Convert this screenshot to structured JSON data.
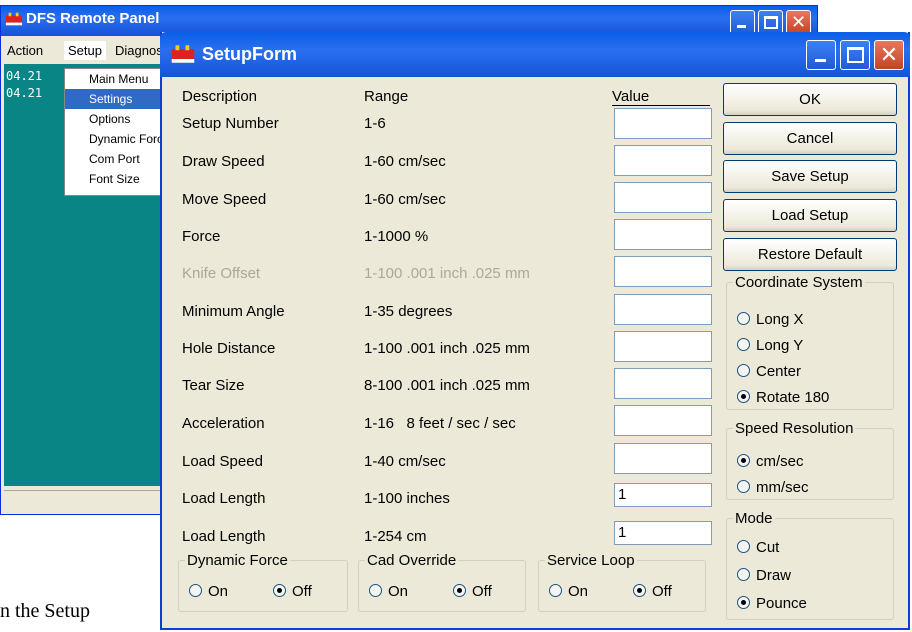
{
  "background_text": "n the Setup",
  "back_window": {
    "title": "DFS Remote Panel",
    "menu": [
      "Action",
      "Setup",
      "Diagnos"
    ],
    "console_lines": [
      "04.21",
      "04.21"
    ],
    "dropdown": [
      "Main Menu",
      "Settings",
      "Options",
      "Dynamic Forc",
      "Com Port",
      "Font Size"
    ]
  },
  "form": {
    "title": "SetupForm",
    "headers": {
      "description": "Description",
      "range": "Range",
      "value": "Value"
    },
    "rows": [
      {
        "description": "Setup Number",
        "range": "1-6",
        "value": ""
      },
      {
        "description": "Draw Speed",
        "range": "1-60 cm/sec",
        "value": ""
      },
      {
        "description": "Move Speed",
        "range": "1-60 cm/sec",
        "value": ""
      },
      {
        "description": "Force",
        "range": "1-1000 %",
        "value": ""
      },
      {
        "description": "Knife Offset",
        "range": "1-100 .001 inch .025 mm",
        "value": "",
        "disabled": true
      },
      {
        "description": "Minimum Angle",
        "range": "1-35 degrees",
        "value": ""
      },
      {
        "description": "Hole Distance",
        "range": "1-100 .001 inch .025 mm",
        "value": ""
      },
      {
        "description": "Tear Size",
        "range": "8-100 .001 inch .025 mm",
        "value": ""
      },
      {
        "description": "Acceleration",
        "range": "1-16   8 feet / sec / sec",
        "value": ""
      },
      {
        "description": "Load Speed",
        "range": "1-40 cm/sec",
        "value": ""
      },
      {
        "description": "Load Length",
        "range": "1-100 inches",
        "value": "1"
      },
      {
        "description": "Load Length",
        "range": "1-254 cm",
        "value": "1"
      }
    ],
    "buttons": [
      "OK",
      "Cancel",
      "Save Setup",
      "Load Setup",
      "Restore Default"
    ],
    "coordinate_system": {
      "label": "Coordinate System",
      "options": [
        "Long X",
        "Long Y",
        "Center",
        "Rotate 180"
      ],
      "selected": "Rotate 180"
    },
    "speed_resolution": {
      "label": "Speed Resolution",
      "options": [
        "cm/sec",
        "mm/sec"
      ],
      "selected": "cm/sec"
    },
    "mode": {
      "label": "Mode",
      "options": [
        "Cut",
        "Draw",
        "Pounce"
      ],
      "selected": "Pounce"
    },
    "dynamic_force": {
      "label": "Dynamic Force",
      "on": "On",
      "off": "Off",
      "selected": "Off"
    },
    "cad_override": {
      "label": "Cad Override",
      "on": "On",
      "off": "Off",
      "selected": "Off"
    },
    "service_loop": {
      "label": "Service Loop",
      "on": "On",
      "off": "Off",
      "selected": "Off"
    }
  }
}
